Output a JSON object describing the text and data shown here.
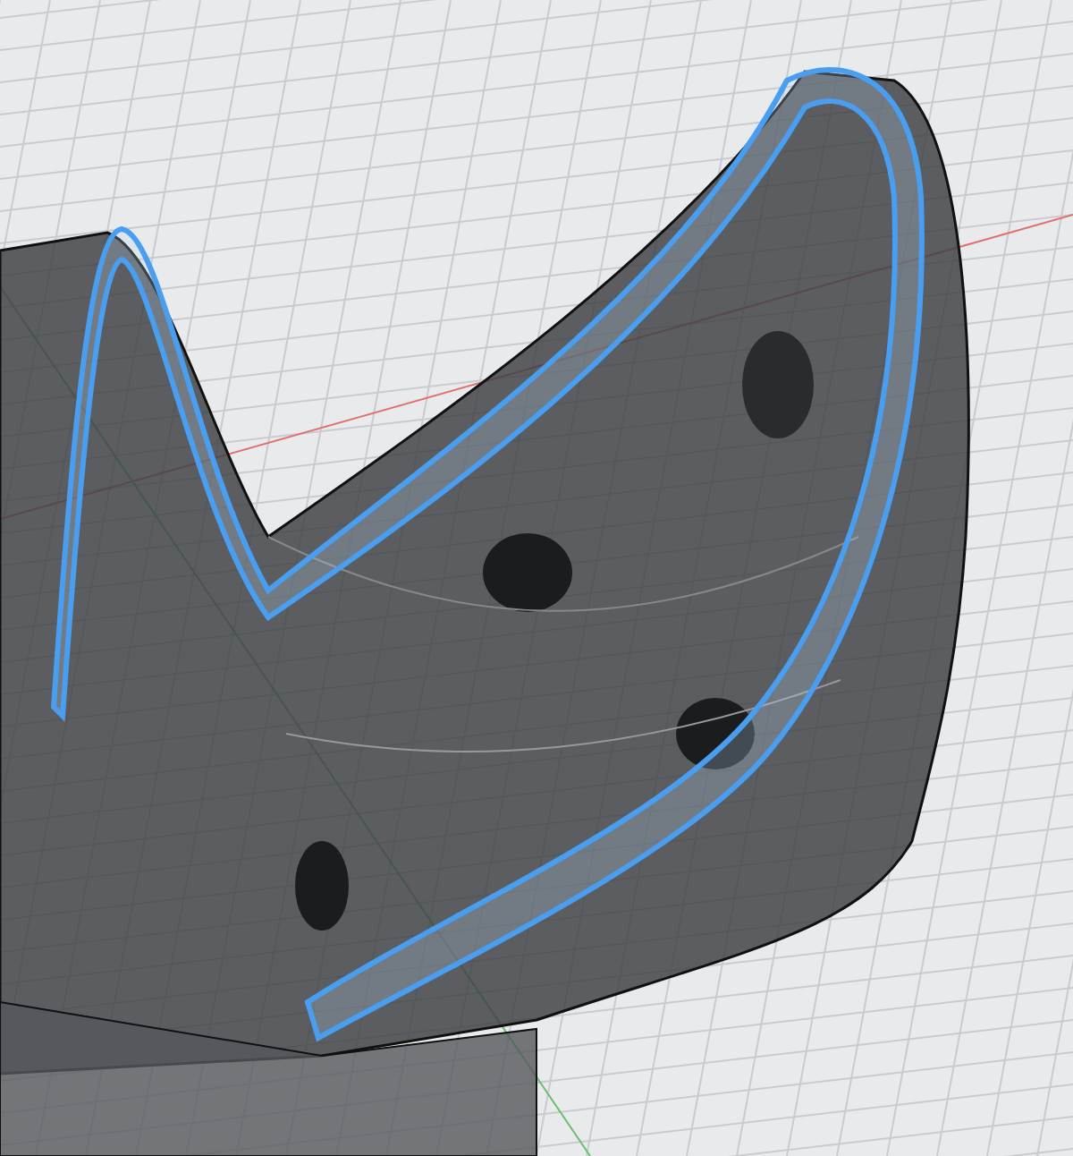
{
  "viewport": {
    "grid_visible": true,
    "selection_highlighted": true
  }
}
